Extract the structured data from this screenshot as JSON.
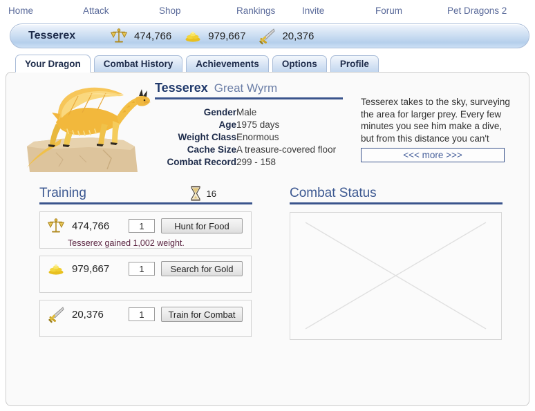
{
  "nav": {
    "items": [
      {
        "label": "Home",
        "name": "nav-home"
      },
      {
        "label": "Attack",
        "name": "nav-attack"
      },
      {
        "label": "Shop",
        "name": "nav-shop"
      },
      {
        "label": "Rankings",
        "name": "nav-rankings"
      },
      {
        "label": "Invite",
        "name": "nav-invite"
      },
      {
        "label": "Forum",
        "name": "nav-forum"
      },
      {
        "label": "Pet Dragons 2",
        "name": "nav-pet-dragons-2"
      }
    ]
  },
  "player_bar": {
    "name": "Tesserex",
    "stats": [
      {
        "icon": "scales-icon",
        "label": "weight",
        "value": "474,766"
      },
      {
        "icon": "gold-coins-icon",
        "label": "gold",
        "value": "979,667"
      },
      {
        "icon": "sword-icon",
        "label": "combat",
        "value": "20,376"
      }
    ]
  },
  "tabs": [
    {
      "label": "Your Dragon",
      "active": true
    },
    {
      "label": "Combat History",
      "active": false
    },
    {
      "label": "Achievements",
      "active": false
    },
    {
      "label": "Options",
      "active": false
    },
    {
      "label": "Profile",
      "active": false
    }
  ],
  "dragon": {
    "name": "Tesserex",
    "species": "Great Wyrm",
    "image_alt": "golden dragon perched on rocky cliff",
    "stats": [
      {
        "label": "Gender",
        "value": "Male"
      },
      {
        "label": "Age",
        "value": "1975 days"
      },
      {
        "label": "Weight Class",
        "value": "Enormous"
      },
      {
        "label": "Cache Size",
        "value": "A treasure-covered floor"
      },
      {
        "label": "Combat Record",
        "value": "299 - 158"
      }
    ],
    "description": "Tesserex takes to the sky, surveying the area for larger prey. Every few minutes you see him make a dive, but from this distance you can't",
    "more_label": "<<< more >>>"
  },
  "training": {
    "title": "Training",
    "hourglass_count": "16",
    "rows": [
      {
        "icon": "scales-icon",
        "value": "474,766",
        "input_value": "1",
        "button_label": "Hunt for Food",
        "message": "Tesserex gained 1,002 weight."
      },
      {
        "icon": "gold-coins-icon",
        "value": "979,667",
        "input_value": "1",
        "button_label": "Search for Gold",
        "message": ""
      },
      {
        "icon": "sword-icon",
        "value": "20,376",
        "input_value": "1",
        "button_label": "Train for Combat",
        "message": ""
      }
    ]
  },
  "combat_status": {
    "title": "Combat Status",
    "placeholder": "broken-image-placeholder"
  },
  "colors": {
    "accent_blue": "#3a548c",
    "heading_blue": "#3c5891",
    "nav_link": "#5a6a9a",
    "message_text": "#5a2340"
  }
}
